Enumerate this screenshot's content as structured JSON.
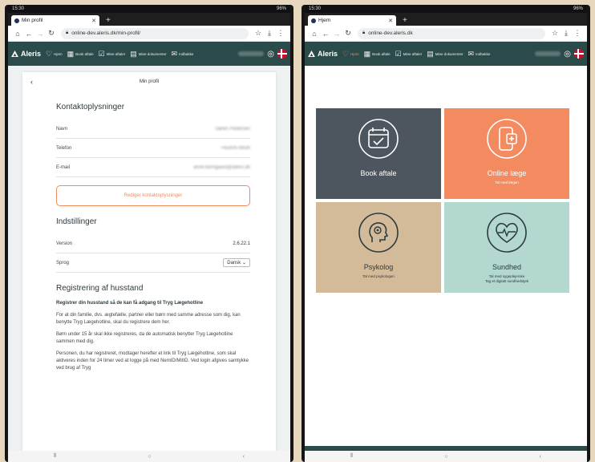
{
  "status": {
    "time": "15:30",
    "battery": "96%"
  },
  "colors": {
    "nav_bg": "#2b4b4b",
    "accent": "#f08a5d",
    "tile_book": "#4d565e",
    "tile_online": "#f48a5f",
    "tile_psykolog": "#d3bb99",
    "tile_sundhed": "#b2d8d0"
  },
  "left": {
    "tab_title": "Min profil",
    "url": "online-dev.aleris.dk/min-profil/",
    "card_title": "Min profil",
    "contact": {
      "heading": "Kontaktoplysninger",
      "rows": [
        {
          "label": "Navn",
          "value": "Søren Pedersen"
        },
        {
          "label": "Telefon",
          "value": "+4540978634"
        },
        {
          "label": "E-mail",
          "value": "anne.borngaard@aleris.dk"
        }
      ],
      "edit_label": "Rediger kontaktoplysninger"
    },
    "settings": {
      "heading": "Indstillinger",
      "version_label": "Version",
      "version_value": "2.6.22.1",
      "lang_label": "Sprog",
      "lang_value": "Dansk"
    },
    "registration": {
      "heading": "Registrering af husstand",
      "subheading": "Registrer din husstand så de kan få adgang til Tryg Lægehotline",
      "p1": "For at din familie, dvs. ægtefælle, partner eller børn med samme adresse som dig, kan benytte Tryg Lægehotline, skal du registrere dem her.",
      "p2": "Børn under 15 år skal ikke registreres, da de automatisk benytter Tryg Lægehotline sammen med dig.",
      "p3": "Personen, du har registreret, modtager herefter et link til Tryg Lægehotline, som skal aktiveres inden for 24 timer ved at logge på med NemID/MitID. Ved login afgives samtykke ved brug af Tryg"
    }
  },
  "right": {
    "tab_title": "Hjem",
    "url": "online-dev.aleris.dk",
    "tiles": [
      {
        "name": "Book aftale",
        "sub": ""
      },
      {
        "name": "Online læge",
        "sub": "Tal med lægen"
      },
      {
        "name": "Psykolog",
        "sub": "Tal med psykologen"
      },
      {
        "name": "Sundhed",
        "sub": "Tal med sygeplejerske\nTag et digitalt sundhedstjek"
      }
    ]
  },
  "nav": {
    "brand": "Aleris",
    "items": [
      "Hjem",
      "Book aftale",
      "Mine aftaler",
      "Mine dokumenter",
      "Indbakke"
    ]
  }
}
